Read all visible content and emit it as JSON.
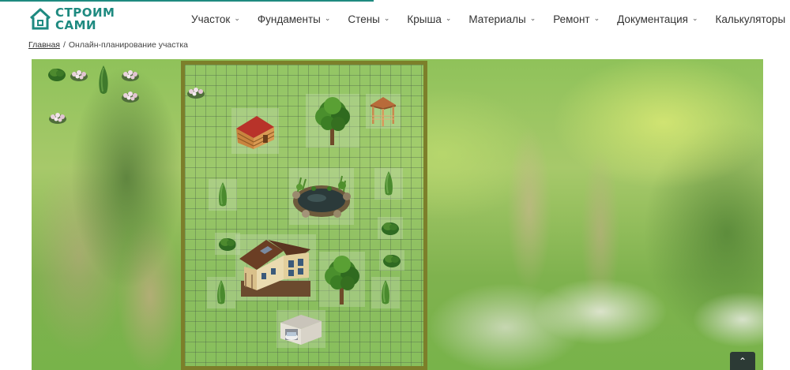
{
  "logo": {
    "line1": "СТРОИМ",
    "line2": "САМИ",
    "color": "#1e8a80"
  },
  "nav": [
    {
      "label": "Участок"
    },
    {
      "label": "Фундаменты"
    },
    {
      "label": "Стены"
    },
    {
      "label": "Крыша"
    },
    {
      "label": "Материалы"
    },
    {
      "label": "Ремонт"
    },
    {
      "label": "Документация"
    },
    {
      "label": "Калькуляторы"
    }
  ],
  "breadcrumb": {
    "home": "Главная",
    "separator": "/",
    "current": "Онлайн-планирование участка"
  },
  "planner": {
    "palette_icons": [
      "bush-icon",
      "flower-bush-icon",
      "cypress-icon",
      "flower-bush-icon",
      "flower-bush-icon",
      "flower-bush-icon"
    ],
    "plot_objects": [
      "bathhouse-icon",
      "deciduous-tree-icon",
      "gazebo-icon",
      "pond-icon",
      "house-icon",
      "garage-icon",
      "cypress-icon",
      "bush-icon"
    ]
  },
  "colors": {
    "accent": "#1e8a80",
    "plot_border": "#7c7f2a",
    "scroll_button": "#2c3a35"
  },
  "scroll_top_icon": "chevron-up-icon"
}
